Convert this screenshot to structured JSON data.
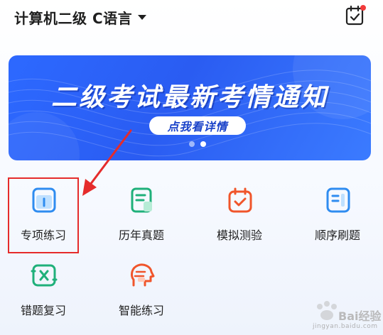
{
  "header": {
    "subject_title": "计算机二级 C语言",
    "checkin_icon": "calendar-check-icon"
  },
  "banner": {
    "title": "二级考试最新考情通知",
    "button_label": "点我看详情",
    "page_count": 2,
    "active_index": 1
  },
  "menu": {
    "items": [
      {
        "label": "专项练习",
        "icon": "book-icon",
        "color": "#2f8cf0"
      },
      {
        "label": "历年真题",
        "icon": "document-list-icon",
        "color": "#1fb07a"
      },
      {
        "label": "模拟测验",
        "icon": "calendar-check-icon",
        "color": "#f0552b"
      },
      {
        "label": "顺序刷题",
        "icon": "list-icon",
        "color": "#2f8cf0"
      },
      {
        "label": "错题复习",
        "icon": "wrong-card-icon",
        "color": "#1fb07a"
      },
      {
        "label": "智能练习",
        "icon": "ai-head-icon",
        "color": "#f0552b"
      }
    ]
  },
  "watermark": {
    "text": "Bai经验",
    "url": "jingyan.baidu.com"
  },
  "colors": {
    "accent_blue": "#2d69ff",
    "highlight_red": "#e52b2b"
  }
}
